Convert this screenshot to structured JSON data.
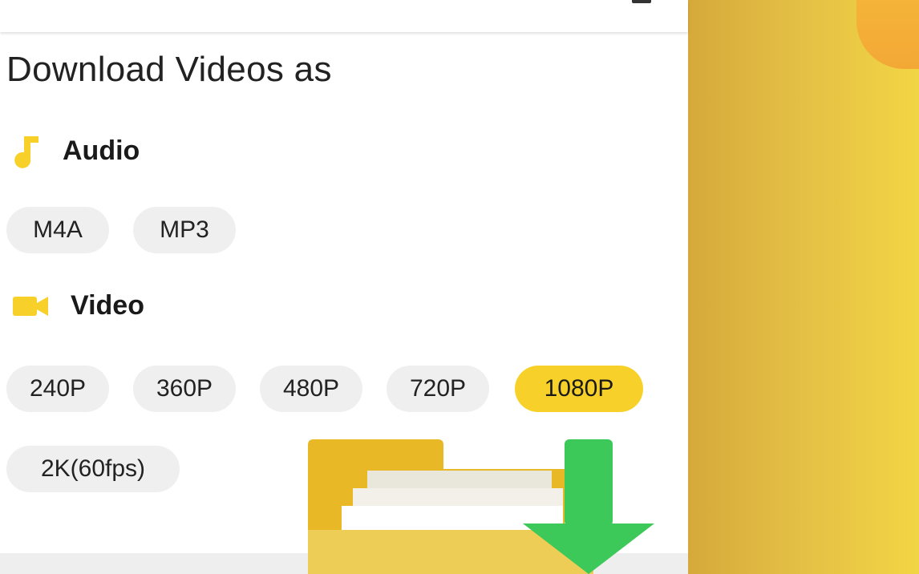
{
  "title": "Download Videos as",
  "audio": {
    "label": "Audio",
    "icon": "music-note-icon",
    "options": [
      "M4A",
      "MP3"
    ]
  },
  "video": {
    "label": "Video",
    "icon": "video-camera-icon",
    "options": [
      "240P",
      "360P",
      "480P",
      "720P",
      "1080P",
      "2K(60fps)"
    ],
    "selected": "1080P"
  },
  "colors": {
    "accent": "#f7d12a",
    "chip_bg": "#efefef",
    "download_arrow": "#3dc85a",
    "folder": "#eac94a"
  }
}
